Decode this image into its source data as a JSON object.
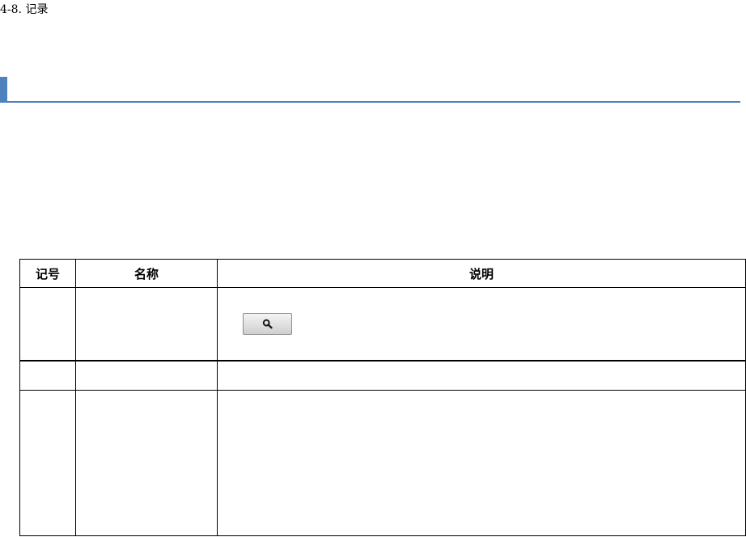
{
  "section": {
    "title": "4-8. 记录"
  },
  "colors": {
    "heading_accent": "#4f81bd",
    "table_border": "#000000"
  },
  "table": {
    "headers": {
      "code": "记号",
      "name": "名称",
      "description": "说明"
    },
    "rows": [
      {
        "code": "",
        "name": "",
        "description": "",
        "icon": "search-icon"
      },
      {
        "code": "",
        "name": "",
        "description": ""
      },
      {
        "code": "",
        "name": "",
        "description": ""
      }
    ]
  }
}
